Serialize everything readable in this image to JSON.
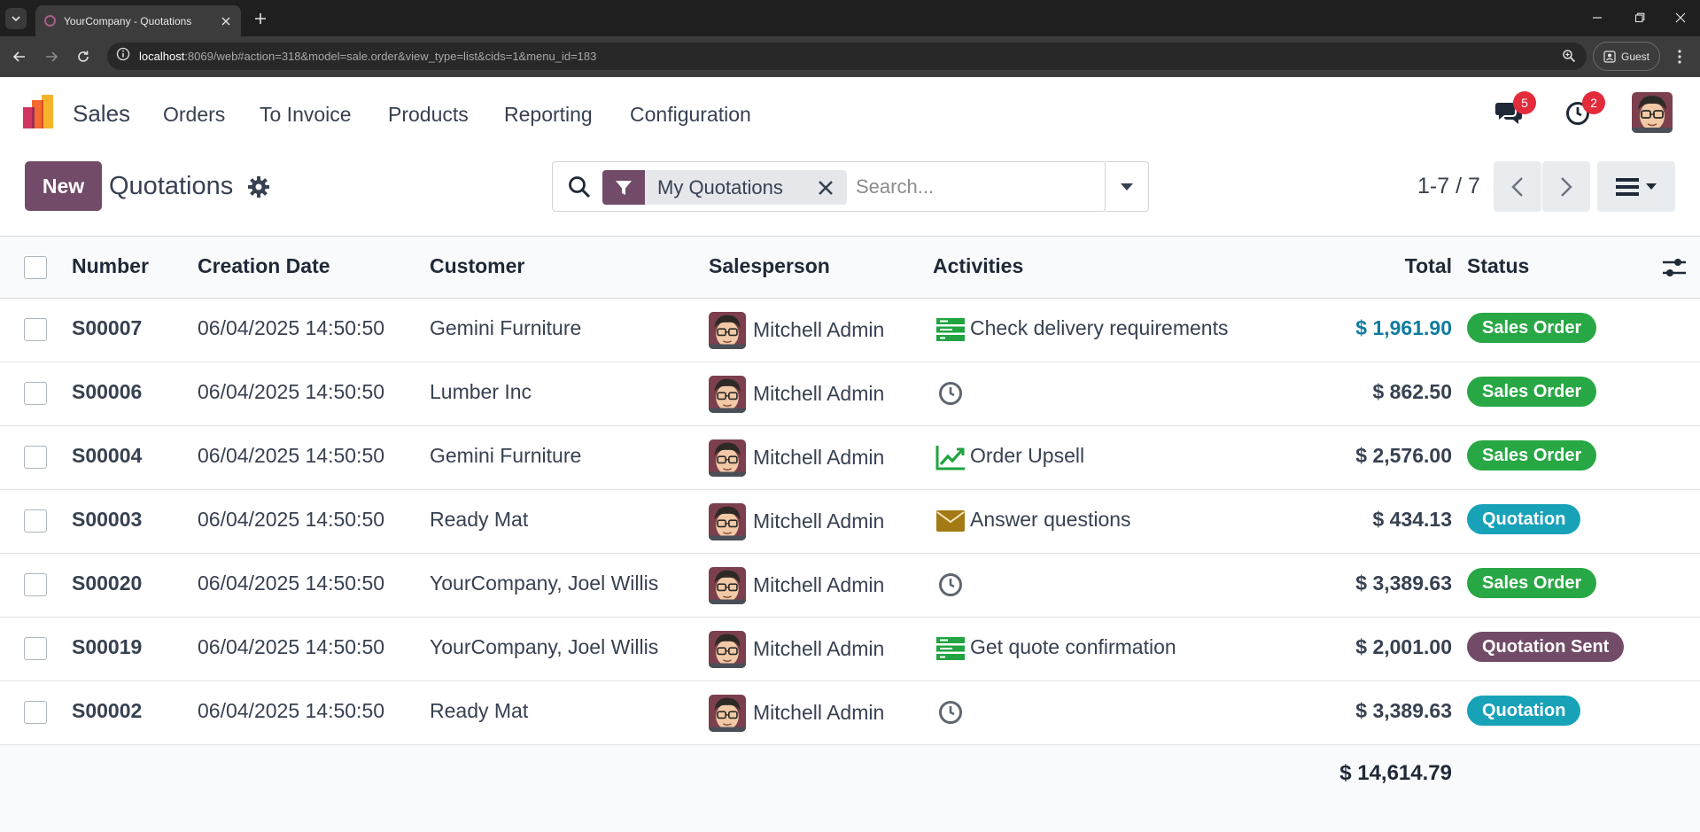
{
  "browser": {
    "tab_title": "YourCompany - Quotations",
    "url_host": "localhost",
    "url_rest": ":8069/web#action=318&model=sale.order&view_type=list&cids=1&menu_id=183",
    "profile_label": "Guest"
  },
  "navbar": {
    "app_name": "Sales",
    "menu": [
      "Orders",
      "To Invoice",
      "Products",
      "Reporting",
      "Configuration"
    ],
    "messages_count": "5",
    "activities_count": "2"
  },
  "control_panel": {
    "new_label": "New",
    "title": "Quotations",
    "facet_label": "My Quotations",
    "search_placeholder": "Search...",
    "pager": "1-7 / 7"
  },
  "table": {
    "headers": {
      "number": "Number",
      "creation_date": "Creation Date",
      "customer": "Customer",
      "salesperson": "Salesperson",
      "activities": "Activities",
      "total": "Total",
      "status": "Status"
    },
    "rows": [
      {
        "number": "S00007",
        "date": "06/04/2025 14:50:50",
        "customer": "Gemini Furniture",
        "salesperson": "Mitchell Admin",
        "activity_icon": "todo-icon",
        "activity": "Check delivery requirements",
        "total": "$ 1,961.90",
        "status": "Sales Order"
      },
      {
        "number": "S00006",
        "date": "06/04/2025 14:50:50",
        "customer": "Lumber Inc",
        "salesperson": "Mitchell Admin",
        "activity_icon": "clock-icon",
        "activity": "",
        "total": "$ 862.50",
        "status": "Sales Order"
      },
      {
        "number": "S00004",
        "date": "06/04/2025 14:50:50",
        "customer": "Gemini Furniture",
        "salesperson": "Mitchell Admin",
        "activity_icon": "chart-line-icon",
        "activity": "Order Upsell",
        "total": "$ 2,576.00",
        "status": "Sales Order"
      },
      {
        "number": "S00003",
        "date": "06/04/2025 14:50:50",
        "customer": "Ready Mat",
        "salesperson": "Mitchell Admin",
        "activity_icon": "envelope-icon",
        "activity": "Answer questions",
        "total": "$ 434.13",
        "status": "Quotation"
      },
      {
        "number": "S00020",
        "date": "06/04/2025 14:50:50",
        "customer": "YourCompany, Joel Willis",
        "salesperson": "Mitchell Admin",
        "activity_icon": "clock-icon",
        "activity": "",
        "total": "$ 3,389.63",
        "status": "Sales Order"
      },
      {
        "number": "S00019",
        "date": "06/04/2025 14:50:50",
        "customer": "YourCompany, Joel Willis",
        "salesperson": "Mitchell Admin",
        "activity_icon": "todo-icon",
        "activity": "Get quote confirmation",
        "total": "$ 2,001.00",
        "status": "Quotation Sent"
      },
      {
        "number": "S00002",
        "date": "06/04/2025 14:50:50",
        "customer": "Ready Mat",
        "salesperson": "Mitchell Admin",
        "activity_icon": "clock-icon",
        "activity": "",
        "total": "$ 3,389.63",
        "status": "Quotation"
      }
    ],
    "grand_total": "$ 14,614.79"
  },
  "colors": {
    "brand": "#714b67",
    "sales_order": "#28a745",
    "quotation": "#17a2b8",
    "quotation_sent": "#714b67",
    "highlight_total": "#0f7c9e",
    "activity_green": "#21a441",
    "activity_amber": "#a37a14"
  }
}
